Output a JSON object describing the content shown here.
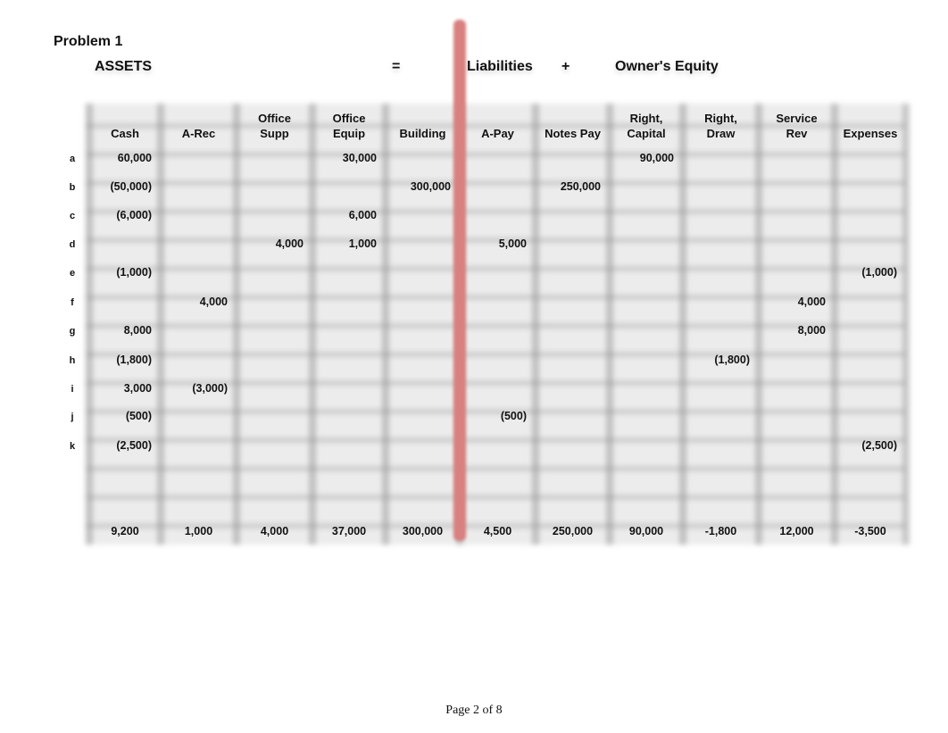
{
  "title": "Problem 1",
  "equation": {
    "assets": "ASSETS",
    "equals": "=",
    "liabilities": "Liabilities",
    "plus": "+",
    "equity": "Owner's Equity"
  },
  "columns": [
    [
      "Cash"
    ],
    [
      "A-Rec"
    ],
    [
      "Office",
      "Supp"
    ],
    [
      "Office",
      "Equip"
    ],
    [
      "Building"
    ],
    [
      "A-Pay"
    ],
    [
      "Notes Pay"
    ],
    [
      "Right,",
      "Capital"
    ],
    [
      "Right,",
      "Draw"
    ],
    [
      "Service",
      "Rev"
    ],
    [
      "Expenses"
    ]
  ],
  "rows": [
    {
      "label": "a",
      "cells": [
        "60,000",
        "",
        "",
        "30,000",
        "",
        "",
        "",
        "90,000",
        "",
        "",
        ""
      ]
    },
    {
      "label": "b",
      "cells": [
        "(50,000)",
        "",
        "",
        "",
        "300,000",
        "",
        "250,000",
        "",
        "",
        "",
        ""
      ]
    },
    {
      "label": "c",
      "cells": [
        "(6,000)",
        "",
        "",
        "6,000",
        "",
        "",
        "",
        "",
        "",
        "",
        ""
      ]
    },
    {
      "label": "d",
      "cells": [
        "",
        "",
        "4,000",
        "1,000",
        "",
        "5,000",
        "",
        "",
        "",
        "",
        ""
      ]
    },
    {
      "label": "e",
      "cells": [
        "(1,000)",
        "",
        "",
        "",
        "",
        "",
        "",
        "",
        "",
        "",
        "(1,000)"
      ]
    },
    {
      "label": "f",
      "cells": [
        "",
        "4,000",
        "",
        "",
        "",
        "",
        "",
        "",
        "",
        "4,000",
        ""
      ]
    },
    {
      "label": "g",
      "cells": [
        "8,000",
        "",
        "",
        "",
        "",
        "",
        "",
        "",
        "",
        "8,000",
        ""
      ]
    },
    {
      "label": "h",
      "cells": [
        "(1,800)",
        "",
        "",
        "",
        "",
        "",
        "",
        "",
        "(1,800)",
        "",
        ""
      ]
    },
    {
      "label": "i",
      "cells": [
        "3,000",
        "(3,000)",
        "",
        "",
        "",
        "",
        "",
        "",
        "",
        "",
        ""
      ]
    },
    {
      "label": "j",
      "cells": [
        "(500)",
        "",
        "",
        "",
        "",
        "(500)",
        "",
        "",
        "",
        "",
        ""
      ]
    },
    {
      "label": "k",
      "cells": [
        "(2,500)",
        "",
        "",
        "",
        "",
        "",
        "",
        "",
        "",
        "",
        "(2,500)"
      ]
    }
  ],
  "totals": [
    "9,200",
    "1,000",
    "4,000",
    "37,000",
    "300,000",
    "4,500",
    "250,000",
    "90,000",
    "-1,800",
    "12,000",
    "-3,500"
  ],
  "footer": "Page 2 of 8",
  "colors": {
    "divider": "#d98080"
  }
}
